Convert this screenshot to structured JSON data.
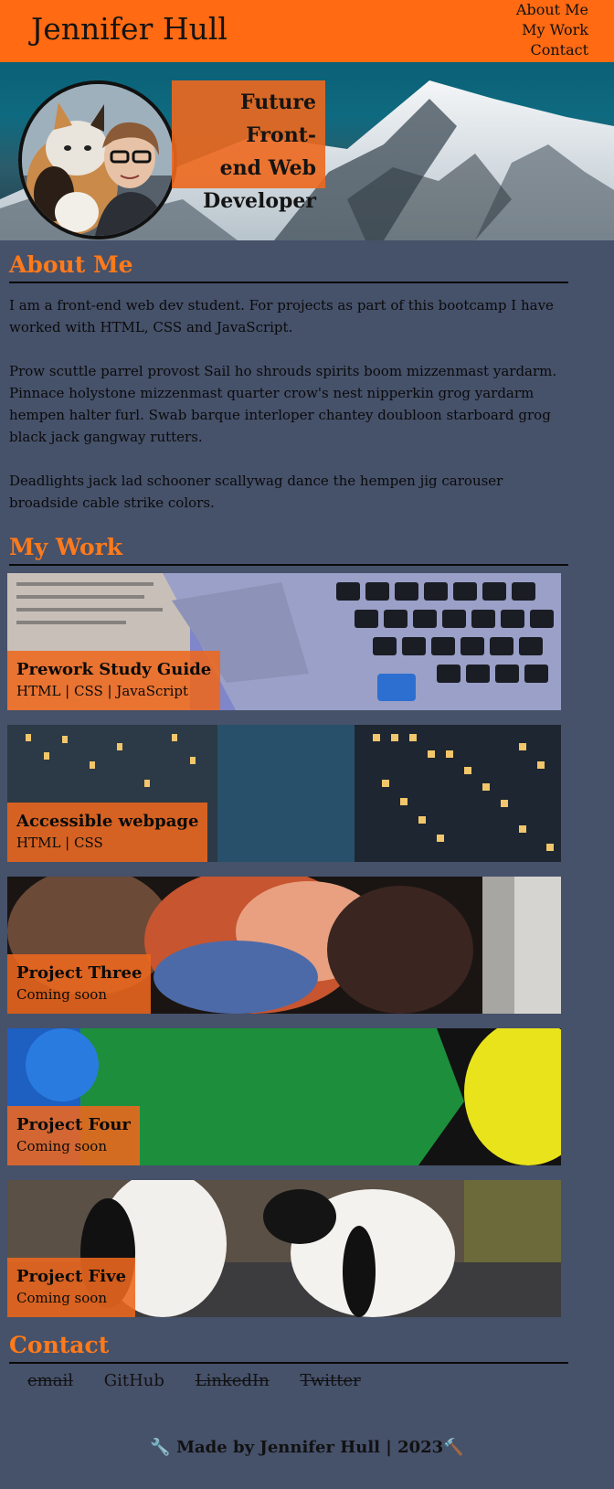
{
  "header": {
    "site_title": "Jennifer Hull",
    "nav": [
      {
        "label": "About Me"
      },
      {
        "label": "My Work"
      },
      {
        "label": "Contact"
      }
    ]
  },
  "hero": {
    "tagline_lines": [
      "Future Front-",
      "end Web",
      "Developer"
    ]
  },
  "about": {
    "title": "About Me",
    "paragraphs": [
      "I am a front-end web dev student. For projects as part of this bootcamp I have worked with HTML, CSS and JavaScript.",
      "Prow scuttle parrel provost Sail ho shrouds spirits boom mizzenmast yardarm. Pinnace holystone mizzenmast quarter crow's nest nipperkin grog yardarm hempen halter furl. Swab barque interloper chantey doubloon starboard grog black jack gangway rutters.",
      "Deadlights jack lad schooner scallywag dance the hempen jig carouser broadside cable strike colors."
    ]
  },
  "work": {
    "title": "My Work",
    "projects": [
      {
        "title": "Prework Study Guide",
        "tech": "HTML | CSS | JavaScript"
      },
      {
        "title": "Accessible webpage",
        "tech": "HTML | CSS"
      },
      {
        "title": "Project Three",
        "tech": "Coming soon"
      },
      {
        "title": "Project Four",
        "tech": "Coming soon"
      },
      {
        "title": "Project Five",
        "tech": "Coming soon"
      }
    ]
  },
  "contact": {
    "title": "Contact",
    "links": [
      {
        "label": "email",
        "struck": true
      },
      {
        "label": "GitHub",
        "struck": false
      },
      {
        "label": "LinkedIn",
        "struck": true
      },
      {
        "label": "Twitter",
        "struck": true
      }
    ]
  },
  "footer": {
    "text": "Made by Jennifer Hull | 2023",
    "left_emoji": "🔧",
    "right_emoji": "🔨"
  },
  "colors": {
    "accent": "#ff6a12",
    "background": "#46516a",
    "caption": "#ed681e"
  }
}
